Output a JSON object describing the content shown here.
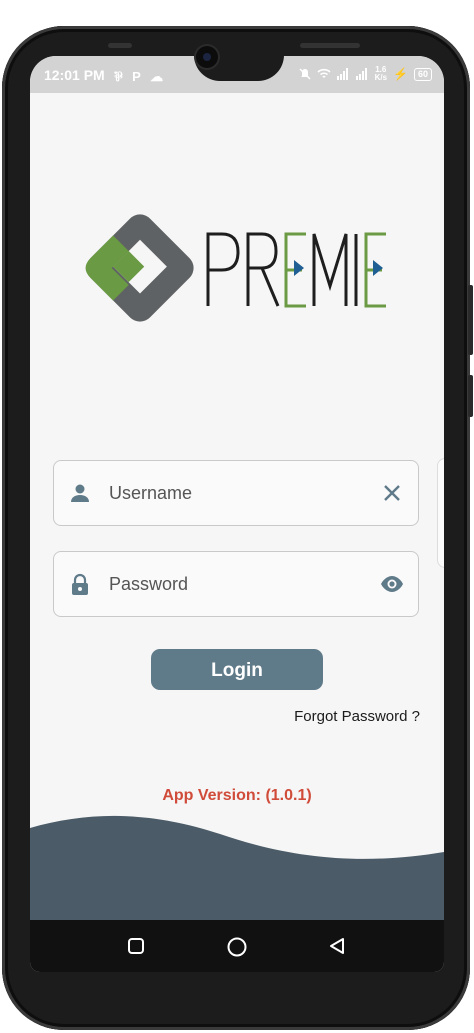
{
  "status": {
    "time": "12:01 PM",
    "left_icons": "⅌ P ☁",
    "net_speed_value": "1.6",
    "net_speed_unit": "K/s",
    "battery": "60"
  },
  "brand": {
    "logo_text": "PREMIER",
    "colors": {
      "gray": "#5f6264",
      "green": "#6a9a43",
      "dark": "#1e1e1e",
      "accent_blue": "#1f5f93"
    }
  },
  "form": {
    "username": {
      "placeholder": "Username",
      "icon": "person-icon",
      "trailing_icon": "close-icon"
    },
    "password": {
      "placeholder": "Password",
      "icon": "lock-icon",
      "trailing_icon": "eye-icon"
    },
    "login_label": "Login",
    "forgot_label": "Forgot Password ?"
  },
  "footer": {
    "version_text": "App Version: (1.0.1)",
    "wave_color": "#4b5c68"
  },
  "navbar": {
    "buttons": [
      "recents-button",
      "home-button",
      "back-button"
    ]
  }
}
